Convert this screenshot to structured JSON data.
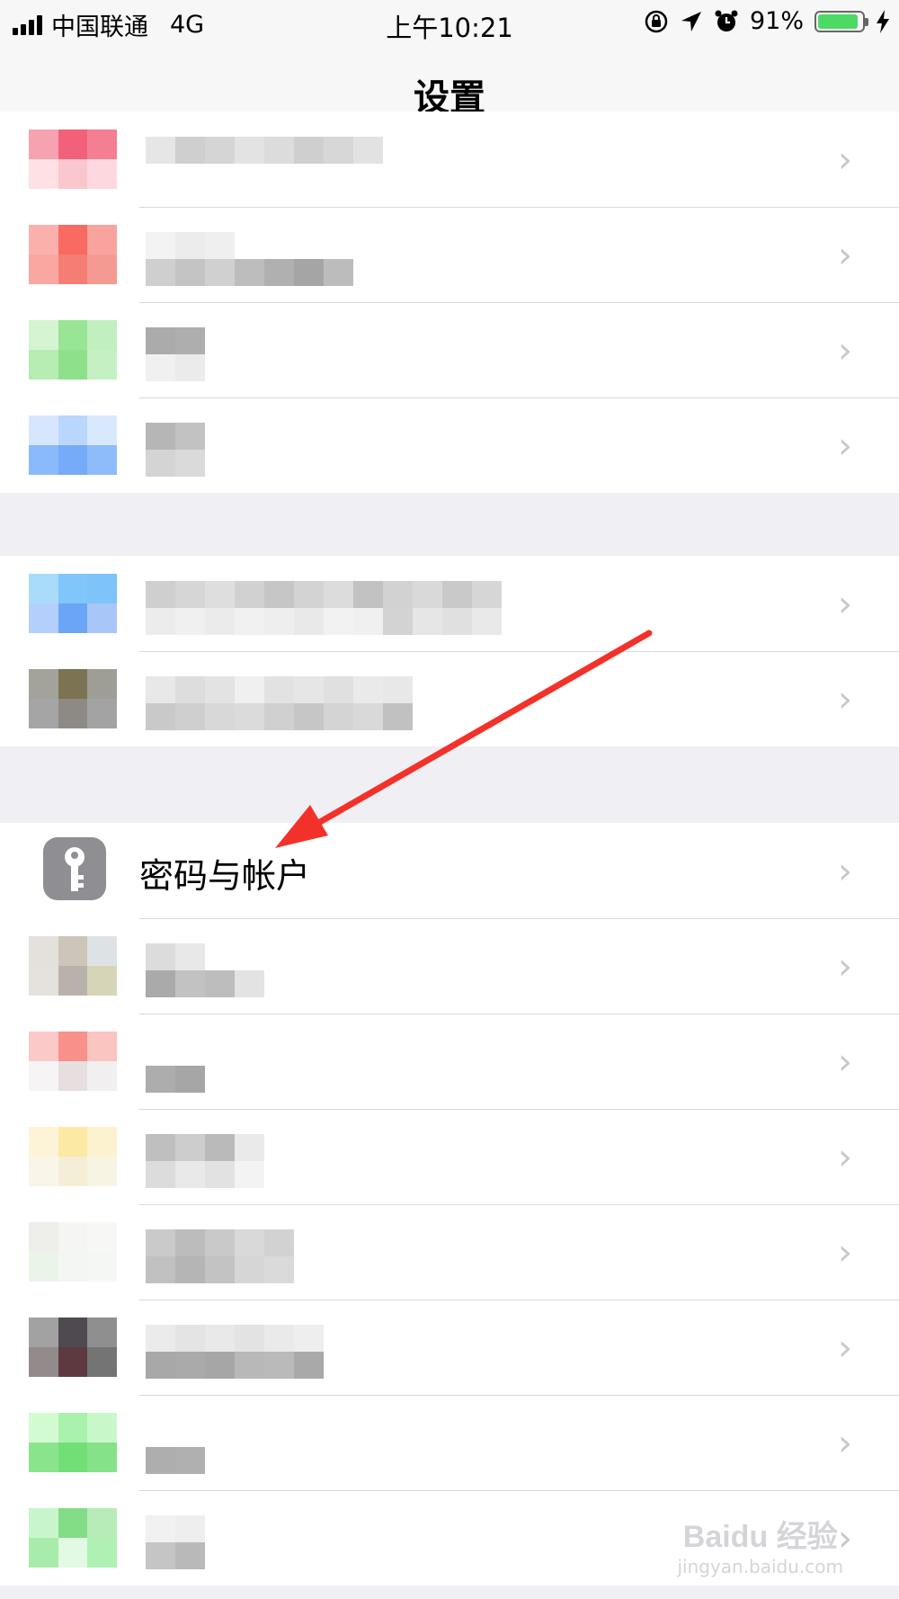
{
  "status_bar": {
    "carrier": "中国联通",
    "network": "4G",
    "time": "上午10:21",
    "battery_percent": "91%",
    "battery_level": 0.91,
    "icons": [
      "signal-icon",
      "orientation-lock-icon",
      "location-icon",
      "alarm-icon",
      "battery-icon",
      "charging-icon"
    ]
  },
  "nav": {
    "title": "设置"
  },
  "groups": [
    {
      "rows": [
        "blurred",
        "blurred",
        "blurred",
        "blurred"
      ]
    },
    {
      "rows": [
        "blurred",
        "blurred"
      ]
    },
    {
      "rows": [
        {
          "label": "密码与帐户",
          "icon": "key-icon"
        },
        "blurred",
        "blurred",
        "blurred",
        "blurred",
        "blurred",
        "blurred",
        "blurred"
      ]
    }
  ],
  "chevron_glyph": "›",
  "annotation": {
    "type": "red-arrow",
    "points_to": "密码与帐户",
    "color": "#f2322a"
  },
  "watermark": {
    "logo": "Baidu 经验",
    "url": "jingyan.baidu.com"
  },
  "colors": {
    "background": "#efeff4",
    "cell": "#ffffff",
    "chevron": "#c7c7cc",
    "key_icon_bg": "#8e8e93",
    "battery_fill": "#4cd964"
  }
}
